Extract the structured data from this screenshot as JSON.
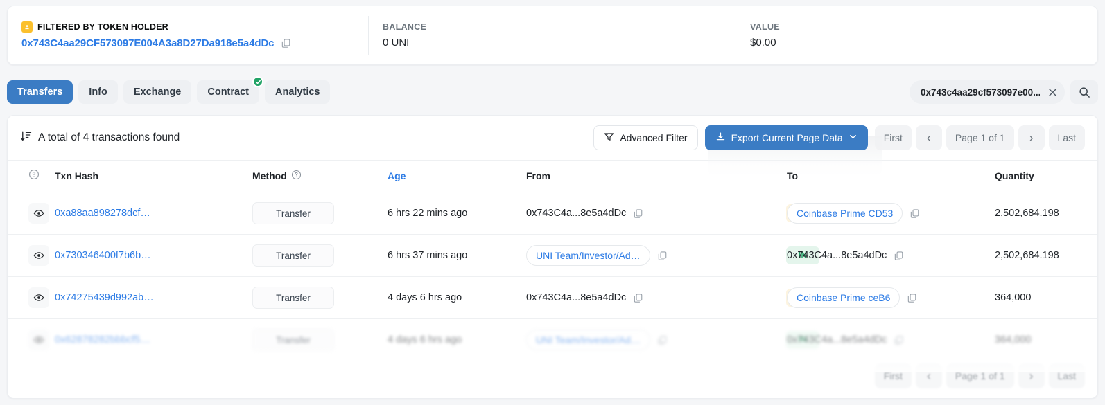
{
  "summary": {
    "filtered_label": "FILTERED BY TOKEN HOLDER",
    "holder_address": "0x743C4aa29CF573097E004A3a8D27Da918e5a4dDc",
    "balance_label": "BALANCE",
    "balance_value": "0 UNI",
    "value_label": "VALUE",
    "value_value": "$0.00"
  },
  "tabs": [
    {
      "label": "Transfers",
      "active": true,
      "badge": false
    },
    {
      "label": "Info",
      "active": false,
      "badge": false
    },
    {
      "label": "Exchange",
      "active": false,
      "badge": false
    },
    {
      "label": "Contract",
      "active": false,
      "badge": true
    },
    {
      "label": "Analytics",
      "active": false,
      "badge": false
    }
  ],
  "search": {
    "value": "0x743c4aa29cf573097e00...",
    "placeholder": "Search"
  },
  "toolbar": {
    "total_text": "A total of 4 transactions found",
    "advanced_filter_label": "Advanced Filter",
    "export_label": "Export Current Page Data"
  },
  "pagination": {
    "first": "First",
    "prev": "‹",
    "page": "Page 1 of 1",
    "next": "›",
    "last": "Last"
  },
  "table": {
    "columns": [
      "",
      "Txn Hash",
      "Method",
      "Age",
      "From",
      "",
      "To",
      "Quantity"
    ],
    "rows": [
      {
        "hash": "0xa88aa898278dcf…",
        "method": "Transfer",
        "age": "6 hrs 22 mins ago",
        "from_text": "0x743C4a...8e5a4dDc",
        "from_is_pill": false,
        "direction": "OUT",
        "to_text": "Coinbase Prime CD53",
        "to_is_pill": true,
        "quantity": "2,502,684.198",
        "faded": false
      },
      {
        "hash": "0x730346400f7b6b…",
        "method": "Transfer",
        "age": "6 hrs 37 mins ago",
        "from_text": "UNI Team/Investor/Ad…",
        "from_is_pill": true,
        "direction": "IN",
        "to_text": "0x743C4a...8e5a4dDc",
        "to_is_pill": false,
        "quantity": "2,502,684.198",
        "faded": false
      },
      {
        "hash": "0x74275439d992ab…",
        "method": "Transfer",
        "age": "4 days 6 hrs ago",
        "from_text": "0x743C4a...8e5a4dDc",
        "from_is_pill": false,
        "direction": "OUT",
        "to_text": "Coinbase Prime ceB6",
        "to_is_pill": true,
        "quantity": "364,000",
        "faded": false
      },
      {
        "hash": "0x62878282bbbcf5…",
        "method": "Transfer",
        "age": "4 days 6 hrs ago",
        "from_text": "UNI Team/Investor/Ad…",
        "from_is_pill": true,
        "direction": "IN",
        "to_text": "0x743C4a...8e5a4dDc",
        "to_is_pill": false,
        "quantity": "364,000",
        "faded": true
      }
    ]
  },
  "colors": {
    "accent": "#3b7cc4",
    "link": "#2c7be5",
    "badge_out_bg": "#fdf4e0",
    "badge_out_fg": "#c79316",
    "badge_in_bg": "#e4f5ec",
    "badge_in_fg": "#1d9f62",
    "holder_badge": "#fbc02d",
    "check_badge": "#21a366"
  },
  "icons": {
    "holder": "user-badge-icon",
    "copy": "copy-icon",
    "sort": "sort-descending-icon",
    "filter": "funnel-icon",
    "download": "download-icon",
    "chevron": "chevron-down-icon",
    "search": "search-icon",
    "close": "close-icon",
    "eye": "eye-icon",
    "help": "question-circle-icon",
    "check": "check-icon"
  }
}
